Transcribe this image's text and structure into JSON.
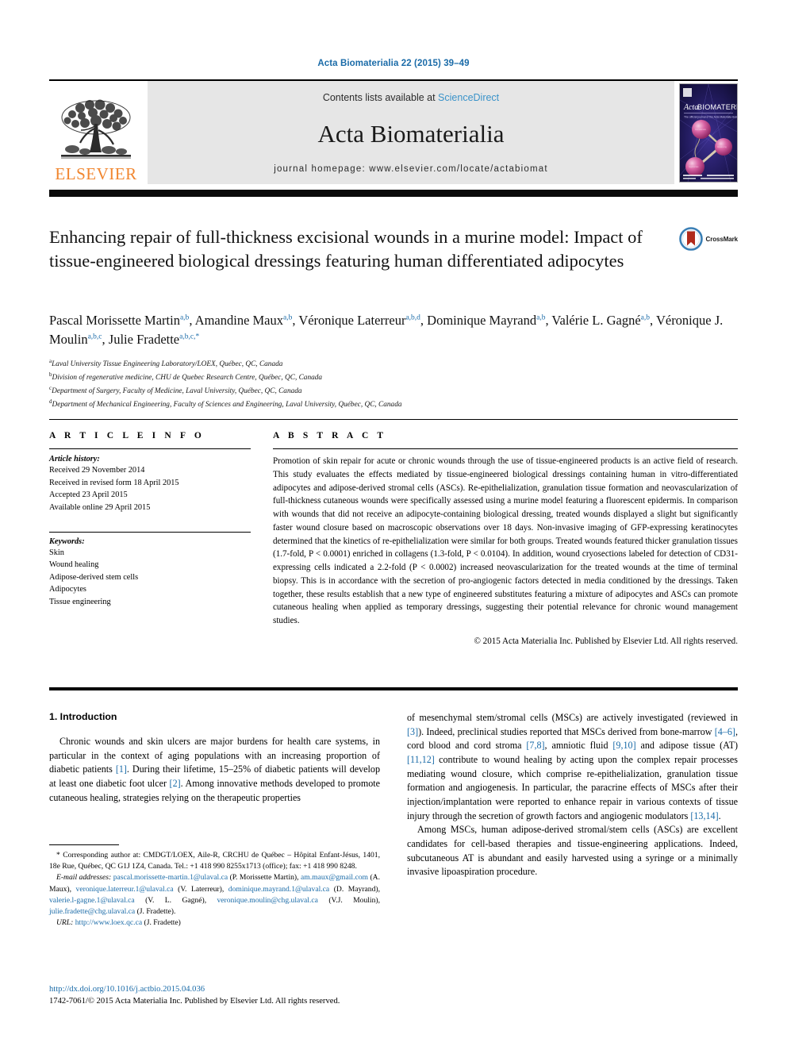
{
  "running_head": "Acta Biomaterialia 22 (2015) 39–49",
  "masthead": {
    "publisher": "ELSEVIER",
    "contents_prefix": "Contents lists available at ",
    "contents_link": "ScienceDirect",
    "journal_title": "Acta Biomaterialia",
    "homepage": "journal homepage: www.elsevier.com/locate/actabiomat",
    "cover_title_italic": "Acta",
    "cover_title_rest": "BIOMATERIALIA",
    "cover_subtitle": "The official journal of the Acta Materialia Association"
  },
  "article": {
    "title": "Enhancing repair of full-thickness excisional wounds in a murine model: Impact of tissue-engineered biological dressings featuring human differentiated adipocytes",
    "crossmark_label": "CrossMark",
    "authors": [
      {
        "name": "Pascal Morissette Martin",
        "sup": "a,b",
        "sep": ", "
      },
      {
        "name": "Amandine Maux",
        "sup": "a,b",
        "sep": ", "
      },
      {
        "name": "Véronique Laterreur",
        "sup": "a,b,d",
        "sep": ", "
      },
      {
        "name": "Dominique Mayrand",
        "sup": "a,b",
        "sep": ", "
      },
      {
        "name": "Valérie L. Gagné",
        "sup": "a,b",
        "sep": ", "
      },
      {
        "name": "Véronique J. Moulin",
        "sup": "a,b,c",
        "sep": ", "
      },
      {
        "name": "Julie Fradette",
        "sup": "a,b,c,*",
        "sep": ""
      }
    ],
    "affiliations": [
      {
        "mark": "a",
        "text": "Laval University Tissue Engineering Laboratory/LOEX, Québec, QC, Canada"
      },
      {
        "mark": "b",
        "text": "Division of regenerative medicine, CHU de Quebec Research Centre, Québec, QC, Canada"
      },
      {
        "mark": "c",
        "text": "Department of Surgery, Faculty of Medicine, Laval University, Québec, QC, Canada"
      },
      {
        "mark": "d",
        "text": "Department of Mechanical Engineering, Faculty of Sciences and Engineering, Laval University, Québec, QC, Canada"
      }
    ]
  },
  "article_info": {
    "heading": "A R T I C L E   I N F O",
    "history_label": "Article history:",
    "history": [
      "Received 29 November 2014",
      "Received in revised form 18 April 2015",
      "Accepted 23 April 2015",
      "Available online 29 April 2015"
    ],
    "keywords_label": "Keywords:",
    "keywords": [
      "Skin",
      "Wound healing",
      "Adipose-derived stem cells",
      "Adipocytes",
      "Tissue engineering"
    ]
  },
  "abstract": {
    "heading": "A B S T R A C T",
    "text": "Promotion of skin repair for acute or chronic wounds through the use of tissue-engineered products is an active field of research. This study evaluates the effects mediated by tissue-engineered biological dressings containing human in vitro-differentiated adipocytes and adipose-derived stromal cells (ASCs). Re-epithelialization, granulation tissue formation and neovascularization of full-thickness cutaneous wounds were specifically assessed using a murine model featuring a fluorescent epidermis. In comparison with wounds that did not receive an adipocyte-containing biological dressing, treated wounds displayed a slight but significantly faster wound closure based on macroscopic observations over 18 days. Non-invasive imaging of GFP-expressing keratinocytes determined that the kinetics of re-epithelialization were similar for both groups. Treated wounds featured thicker granulation tissues (1.7-fold, P < 0.0001) enriched in collagens (1.3-fold, P < 0.0104). In addition, wound cryosections labeled for detection of CD31-expressing cells indicated a 2.2-fold (P < 0.0002) increased neovascularization for the treated wounds at the time of terminal biopsy. This is in accordance with the secretion of pro-angiogenic factors detected in media conditioned by the dressings. Taken together, these results establish that a new type of engineered substitutes featuring a mixture of adipocytes and ASCs can promote cutaneous healing when applied as temporary dressings, suggesting their potential relevance for chronic wound management studies.",
    "copyright": "© 2015 Acta Materialia Inc. Published by Elsevier Ltd. All rights reserved."
  },
  "introduction": {
    "heading": "1. Introduction",
    "left_para_1_a": "Chronic wounds and skin ulcers are major burdens for health care systems, in particular in the context of aging populations with an increasing proportion of diabetic patients ",
    "left_ref_1": "[1]",
    "left_para_1_b": ". During their lifetime, 15–25% of diabetic patients will develop at least one diabetic foot ulcer ",
    "left_ref_2": "[2]",
    "left_para_1_c": ". Among innovative methods developed to promote cutaneous healing, strategies relying on the therapeutic properties",
    "right_para_1_a": "of mesenchymal stem/stromal cells (MSCs) are actively investigated (reviewed in ",
    "right_ref_3": "[3]",
    "right_para_1_b": "). Indeed, preclinical studies reported that MSCs derived from bone-marrow ",
    "right_ref_4": "[4–6]",
    "right_para_1_c": ", cord blood and cord stroma ",
    "right_ref_5": "[7,8]",
    "right_para_1_d": ", amniotic fluid ",
    "right_ref_6": "[9,10]",
    "right_para_1_e": " and adipose tissue (AT) ",
    "right_ref_7": "[11,12]",
    "right_para_1_f": " contribute to wound healing by acting upon the complex repair processes mediating wound closure, which comprise re-epithelialization, granulation tissue formation and angiogenesis. In particular, the paracrine effects of MSCs after their injection/implantation were reported to enhance repair in various contexts of tissue injury through the secretion of growth factors and angiogenic modulators ",
    "right_ref_8": "[13,14]",
    "right_para_1_g": ".",
    "right_para_2": "Among MSCs, human adipose-derived stromal/stem cells (ASCs) are excellent candidates for cell-based therapies and tissue-engineering applications. Indeed, subcutaneous AT is abundant and easily harvested using a syringe or a minimally invasive lipoaspiration procedure."
  },
  "footnote": {
    "corresponding_mark": "*",
    "corresponding_text": "Corresponding author at: CMDGT/LOEX, Aile-R, CRCHU de Québec – Hôpital Enfant-Jésus, 1401, 18e Rue, Québec, QC G1J 1Z4, Canada. Tel.: +1 418 990 8255x1713 (office); fax: +1 418 990 8248.",
    "email_label": "E-mail addresses:",
    "emails": [
      {
        "addr": "pascal.morissette-martin.1@ulaval.ca",
        "who": "(P. Morissette Martin)"
      },
      {
        "addr": "am.maux@gmail.com",
        "who": "(A. Maux)"
      },
      {
        "addr": "veronique.laterreur.1@ulaval.ca",
        "who": "(V. Laterreur)"
      },
      {
        "addr": "dominique.mayrand.1@ulaval.ca",
        "who": "(D. Mayrand)"
      },
      {
        "addr": "valerie.l-gagne.1@ulaval.ca",
        "who": "(V. L. Gagné)"
      },
      {
        "addr": "veronique.moulin@chg.ulaval.ca",
        "who": "(V.J. Moulin)"
      },
      {
        "addr": "julie.fradette@chg.ulaval.ca",
        "who": "(J. Fradette)"
      }
    ],
    "url_label": "URL:",
    "url": "http://www.loex.qc.ca",
    "url_who": "(J. Fradette)"
  },
  "footer": {
    "doi": "http://dx.doi.org/10.1016/j.actbio.2015.04.036",
    "issn_line": "1742-7061/© 2015 Acta Materialia Inc. Published by Elsevier Ltd. All rights reserved."
  },
  "colors": {
    "link": "#1a6ba8",
    "elsevier_orange": "#F1862F",
    "sciencedirect": "#3a93c9",
    "masthead_bg": "#e6e6e6",
    "crossmark_blue": "#3a7fb5",
    "crossmark_red": "#b02a1b"
  }
}
